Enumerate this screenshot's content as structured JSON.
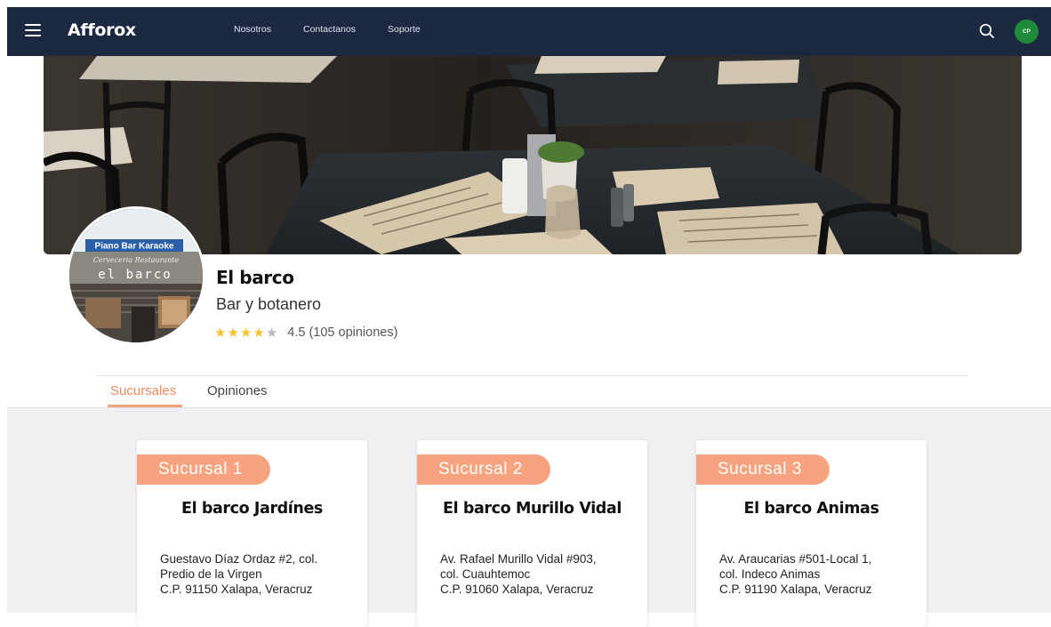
{
  "header": {
    "brand": "Afforox",
    "nav": [
      "Nosotros",
      "Contactanos",
      "Soporte"
    ],
    "avatar_initials": "CP",
    "avatar_color": "#1f8a3a",
    "background_color": "#1c2840"
  },
  "hero": {
    "sign_line1": "Piano Bar Karaoke",
    "sign_line2": "Cerveceria Restaurante",
    "sign_line3": "el barco"
  },
  "business": {
    "name": "El barco",
    "type": "Bar y botanero",
    "rating": 4.5,
    "rating_text": "4.5 (105 opiniones)",
    "stars_filled": 4
  },
  "tabs": [
    {
      "label": "Sucursales",
      "active": true
    },
    {
      "label": "Opiniones",
      "active": false
    }
  ],
  "accent_color": "#f28a5e",
  "branches": [
    {
      "tag": "Sucursal 1",
      "name": "El barco Jardínes",
      "address": [
        "Guestavo Díaz Ordaz #2, col.",
        "Predio de la Virgen",
        "C.P. 91150 Xalapa, Veracruz"
      ]
    },
    {
      "tag": "Sucursal 2",
      "name": "El barco Murillo Vidal",
      "address": [
        "Av. Rafael Murillo Vidal #903,",
        "col. Cuauhtemoc",
        "C.P. 91060 Xalapa, Veracruz"
      ]
    },
    {
      "tag": "Sucursal 3",
      "name": "El barco Animas",
      "address": [
        "Av. Araucarias #501-Local 1,",
        "col. Indeco Animas",
        "C.P. 91190 Xalapa, Veracruz"
      ]
    }
  ]
}
